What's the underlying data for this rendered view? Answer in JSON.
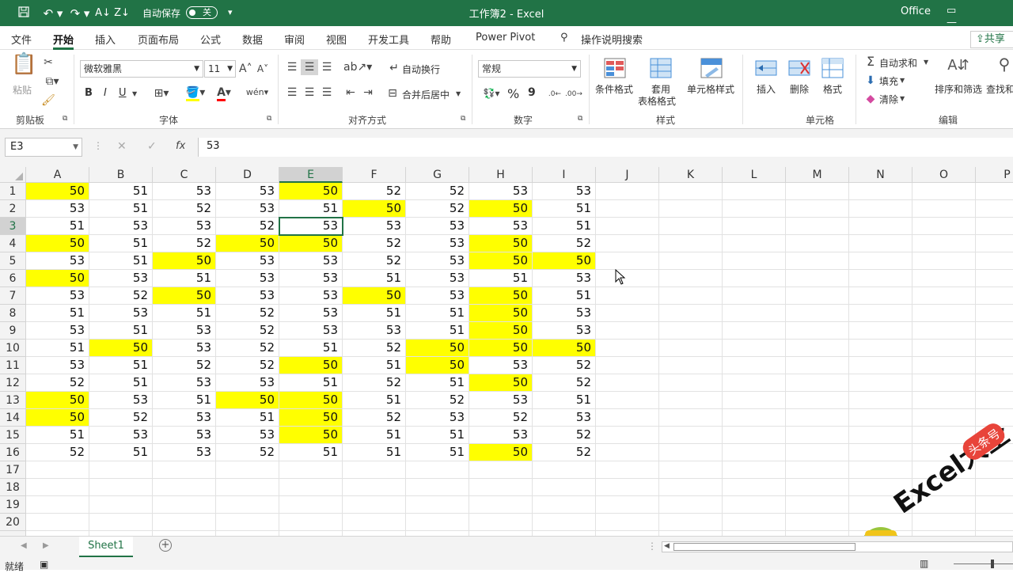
{
  "titlebar": {
    "autosave_label": "自动保存",
    "autosave_state": "关",
    "doc_title": "工作簿2  -  Excel",
    "brand": "Office",
    "icons": [
      "save-icon",
      "undo-icon",
      "redo-icon",
      "sort-asc-icon",
      "sort-desc-icon",
      "customize-icon"
    ]
  },
  "tabs": [
    "文件",
    "开始",
    "插入",
    "页面布局",
    "公式",
    "数据",
    "审阅",
    "视图",
    "开发工具",
    "帮助",
    "Power Pivot"
  ],
  "active_tab": "开始",
  "search_label": "操作说明搜索",
  "share_label": "共享",
  "ribbon": {
    "clipboard": {
      "paste": "粘贴",
      "label": "剪贴板"
    },
    "font": {
      "name": "微软雅黑",
      "size": "11",
      "bold": "B",
      "italic": "I",
      "underline": "U",
      "label": "字体"
    },
    "alignment": {
      "wrap": "自动换行",
      "merge": "合并后居中",
      "label": "对齐方式"
    },
    "number": {
      "format": "常规",
      "percent": "%",
      "comma": "9",
      "label": "数字"
    },
    "styles": {
      "cond": "条件格式",
      "table1": "套用",
      "table2": "表格格式",
      "cell": "单元格样式",
      "label": "样式"
    },
    "cells": {
      "insert": "插入",
      "delete": "删除",
      "format": "格式",
      "label": "单元格"
    },
    "editing": {
      "autosum": "自动求和",
      "fill": "填充",
      "clear": "清除",
      "sort": "排序和筛选",
      "find": "查找和",
      "label": "编辑"
    }
  },
  "formula": {
    "namebox": "E3",
    "cancel": "✕",
    "enter": "✓",
    "fx": "fx",
    "content": "53"
  },
  "columns": [
    "A",
    "B",
    "C",
    "D",
    "E",
    "F",
    "G",
    "H",
    "I",
    "J",
    "K",
    "L",
    "M",
    "N",
    "O",
    "P"
  ],
  "selected_col": "E",
  "selected_row": 3,
  "rows": [
    [
      50,
      51,
      53,
      53,
      50,
      52,
      52,
      53,
      53
    ],
    [
      53,
      51,
      52,
      53,
      51,
      50,
      52,
      50,
      51
    ],
    [
      51,
      53,
      53,
      52,
      53,
      53,
      53,
      53,
      51
    ],
    [
      50,
      51,
      52,
      50,
      50,
      52,
      53,
      50,
      52
    ],
    [
      53,
      51,
      50,
      53,
      53,
      52,
      53,
      50,
      50
    ],
    [
      50,
      53,
      51,
      53,
      53,
      51,
      53,
      51,
      53
    ],
    [
      53,
      52,
      50,
      53,
      53,
      50,
      53,
      50,
      51
    ],
    [
      51,
      53,
      51,
      52,
      53,
      51,
      51,
      50,
      53
    ],
    [
      53,
      51,
      53,
      52,
      53,
      53,
      51,
      50,
      53
    ],
    [
      51,
      50,
      53,
      52,
      51,
      52,
      50,
      50,
      50
    ],
    [
      53,
      51,
      52,
      52,
      50,
      51,
      50,
      53,
      52
    ],
    [
      52,
      51,
      53,
      53,
      51,
      52,
      51,
      50,
      52
    ],
    [
      50,
      53,
      51,
      50,
      50,
      51,
      52,
      53,
      51
    ],
    [
      50,
      52,
      53,
      51,
      50,
      52,
      53,
      52,
      53
    ],
    [
      51,
      53,
      53,
      53,
      50,
      51,
      51,
      53,
      52
    ],
    [
      52,
      51,
      53,
      52,
      51,
      51,
      51,
      50,
      52
    ]
  ],
  "extra_rows": [
    17,
    18,
    19,
    20
  ],
  "highlight_value": 50,
  "highlight_color": "#ffff00",
  "accent_color": "#217346",
  "sheet_tab": "Sheet1",
  "add_sheet": "+",
  "status": "就绪",
  "watermark": {
    "text": "Excel大全",
    "stamp": "头条号"
  }
}
